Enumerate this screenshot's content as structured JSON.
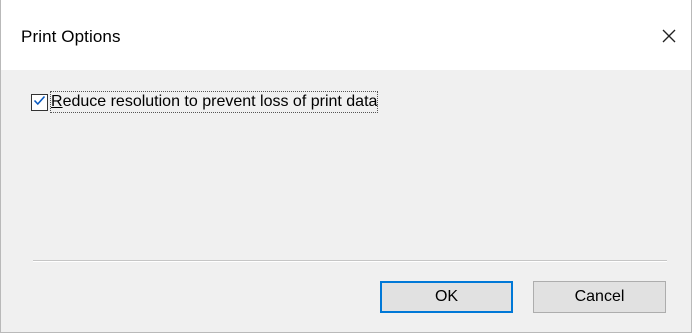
{
  "window": {
    "title": "Print Options",
    "close_icon": "close-icon"
  },
  "option": {
    "label": "Reduce resolution to prevent loss of print data",
    "checked": true,
    "check_icon": "checkmark-icon"
  },
  "buttons": {
    "ok_label": "OK",
    "cancel_label": "Cancel"
  },
  "colors": {
    "accent": "#0078d7",
    "check": "#0a5ac0",
    "dialog_bg": "#f0f0f0",
    "title_bg": "#ffffff"
  }
}
